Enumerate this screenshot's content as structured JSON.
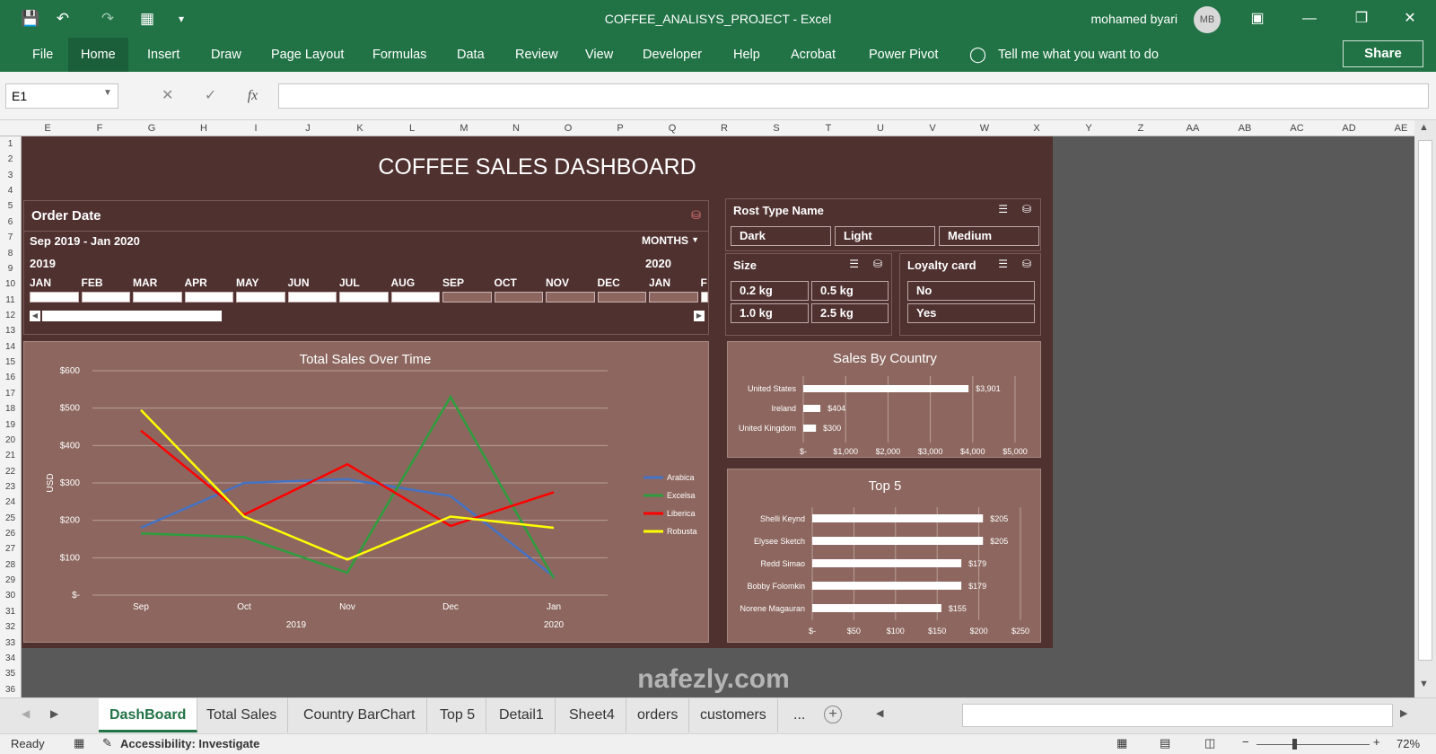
{
  "app": {
    "title": "COFFEE_ANALISYS_PROJECT  -  Excel",
    "user": "mohamed byari",
    "avatar_initials": "MB"
  },
  "ribbon": {
    "tabs": [
      "File",
      "Home",
      "Insert",
      "Draw",
      "Page Layout",
      "Formulas",
      "Data",
      "Review",
      "View",
      "Developer",
      "Help",
      "Acrobat",
      "Power Pivot"
    ],
    "active_tab": "Home",
    "tell_me": "Tell me what you want to do",
    "share": "Share"
  },
  "formula_bar": {
    "name_box": "E1",
    "fx": "fx",
    "value": ""
  },
  "columns": [
    "E",
    "F",
    "G",
    "H",
    "I",
    "J",
    "K",
    "L",
    "M",
    "N",
    "O",
    "P",
    "Q",
    "R",
    "S",
    "T",
    "U",
    "V",
    "W",
    "X",
    "Y",
    "Z",
    "AA",
    "AB",
    "AC",
    "AD",
    "AE"
  ],
  "rows": [
    "1",
    "2",
    "3",
    "4",
    "5",
    "6",
    "7",
    "8",
    "9",
    "10",
    "11",
    "12",
    "13",
    "14",
    "15",
    "16",
    "17",
    "18",
    "19",
    "20",
    "21",
    "22",
    "23",
    "24",
    "25",
    "26",
    "27",
    "28",
    "29",
    "30",
    "31",
    "32",
    "33",
    "34",
    "35",
    "36"
  ],
  "dashboard": {
    "title": "COFFEE SALES DASHBOARD",
    "timeline": {
      "header": "Order Date",
      "range": "Sep 2019 - Jan 2020",
      "level": "MONTHS",
      "year1": "2019",
      "year2": "2020",
      "months": [
        "JAN",
        "FEB",
        "MAR",
        "APR",
        "MAY",
        "JUN",
        "JUL",
        "AUG",
        "SEP",
        "OCT",
        "NOV",
        "DEC",
        "JAN",
        "F"
      ]
    },
    "roast_slicer": {
      "header": "Rost Type Name",
      "items": [
        "Dark",
        "Light",
        "Medium"
      ]
    },
    "size_slicer": {
      "header": "Size",
      "items": [
        "0.2 kg",
        "0.5 kg",
        "1.0 kg",
        "2.5 kg"
      ]
    },
    "loyalty_slicer": {
      "header": "Loyalty card",
      "items": [
        "No",
        "Yes"
      ]
    }
  },
  "chart_data": [
    {
      "type": "line",
      "title": "Total Sales Over Time",
      "ylabel": "USD",
      "x": [
        "Sep",
        "Oct",
        "Nov",
        "Dec",
        "Jan"
      ],
      "x_groups": [
        "2019",
        "2020"
      ],
      "yticks": [
        "$-",
        "$100",
        "$200",
        "$300",
        "$400",
        "$500",
        "$600"
      ],
      "ylim": [
        0,
        600
      ],
      "legend": "right",
      "series": [
        {
          "name": "Arabica",
          "color": "#4472c4",
          "values": [
            180,
            300,
            310,
            265,
            50
          ]
        },
        {
          "name": "Excelsa",
          "color": "#2e9e3e",
          "values": [
            165,
            155,
            60,
            530,
            45
          ]
        },
        {
          "name": "Liberica",
          "color": "#ff0000",
          "values": [
            440,
            215,
            350,
            185,
            275
          ]
        },
        {
          "name": "Robusta",
          "color": "#ffff00",
          "values": [
            495,
            210,
            95,
            210,
            180
          ]
        }
      ]
    },
    {
      "type": "bar",
      "title": "Sales By Country",
      "categories": [
        "United States",
        "Ireland",
        "United Kingdom"
      ],
      "values": [
        3901,
        404,
        300
      ],
      "labels": [
        "$3,901",
        "$404",
        "$300"
      ],
      "xticks": [
        "$-",
        "$1,000",
        "$2,000",
        "$3,000",
        "$4,000",
        "$5,000"
      ],
      "xlim": [
        0,
        5000
      ]
    },
    {
      "type": "bar",
      "title": "Top 5",
      "categories": [
        "Shelli Keynd",
        "Elysee Sketch",
        "Redd Simao",
        "Bobby Folomkin",
        "Norene Magauran"
      ],
      "values": [
        205,
        205,
        179,
        179,
        155
      ],
      "labels": [
        "$205",
        "$205",
        "$179",
        "$179",
        "$155"
      ],
      "xticks": [
        "$-",
        "$50",
        "$100",
        "$150",
        "$200",
        "$250"
      ],
      "xlim": [
        0,
        250
      ]
    }
  ],
  "sheet_tabs": {
    "tabs": [
      "DashBoard",
      "Total Sales",
      "Country BarChart",
      "Top 5",
      "Detail1",
      "Sheet4",
      "orders",
      "customers"
    ],
    "more": "...",
    "active": "DashBoard"
  },
  "status": {
    "ready": "Ready",
    "accessibility": "Accessibility: Investigate",
    "zoom": "72%"
  },
  "watermark": "nafezly.com"
}
